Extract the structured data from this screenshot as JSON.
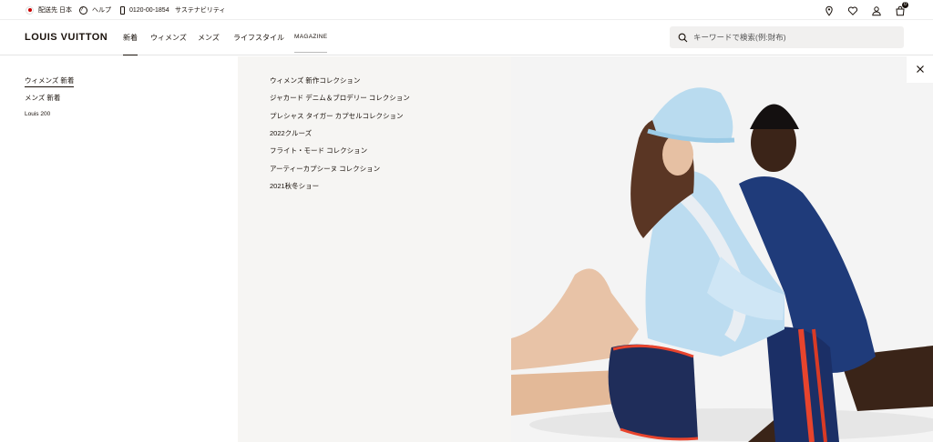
{
  "utility": {
    "ship_to": "配送先 日本",
    "help": "ヘルプ",
    "phone": "0120-00-1854",
    "sustainability": "サステナビリティ",
    "cart_count": "0"
  },
  "nav": {
    "logo": "LOUIS VUITTON",
    "items": [
      "新着",
      "ウィメンズ",
      "メンズ",
      "ライフスタイル",
      "MAGAZINE"
    ]
  },
  "search": {
    "placeholder": "キーワードで検索(例:財布)"
  },
  "menu": {
    "primary": [
      "ウィメンズ 新着",
      "メンズ 新着",
      "Louis 200"
    ],
    "secondary": [
      "ウィメンズ 新作コレクション",
      "ジャカード デニム＆ブロデリー コレクション",
      "プレシャス タイガー カプセルコレクション",
      "2022クルーズ",
      "フライト・モード コレクション",
      "アーティーカプシーヌ コレクション",
      "2021秋冬ショー"
    ]
  },
  "colors": {
    "text": "#19110b",
    "panel_gray": "#f6f5f3",
    "search_bg": "#f1f0ef"
  },
  "icons": [
    "japan-flag-icon",
    "help-icon",
    "phone-icon",
    "location-pin-icon",
    "heart-icon",
    "user-icon",
    "shopping-bag-icon",
    "search-icon",
    "close-icon"
  ]
}
